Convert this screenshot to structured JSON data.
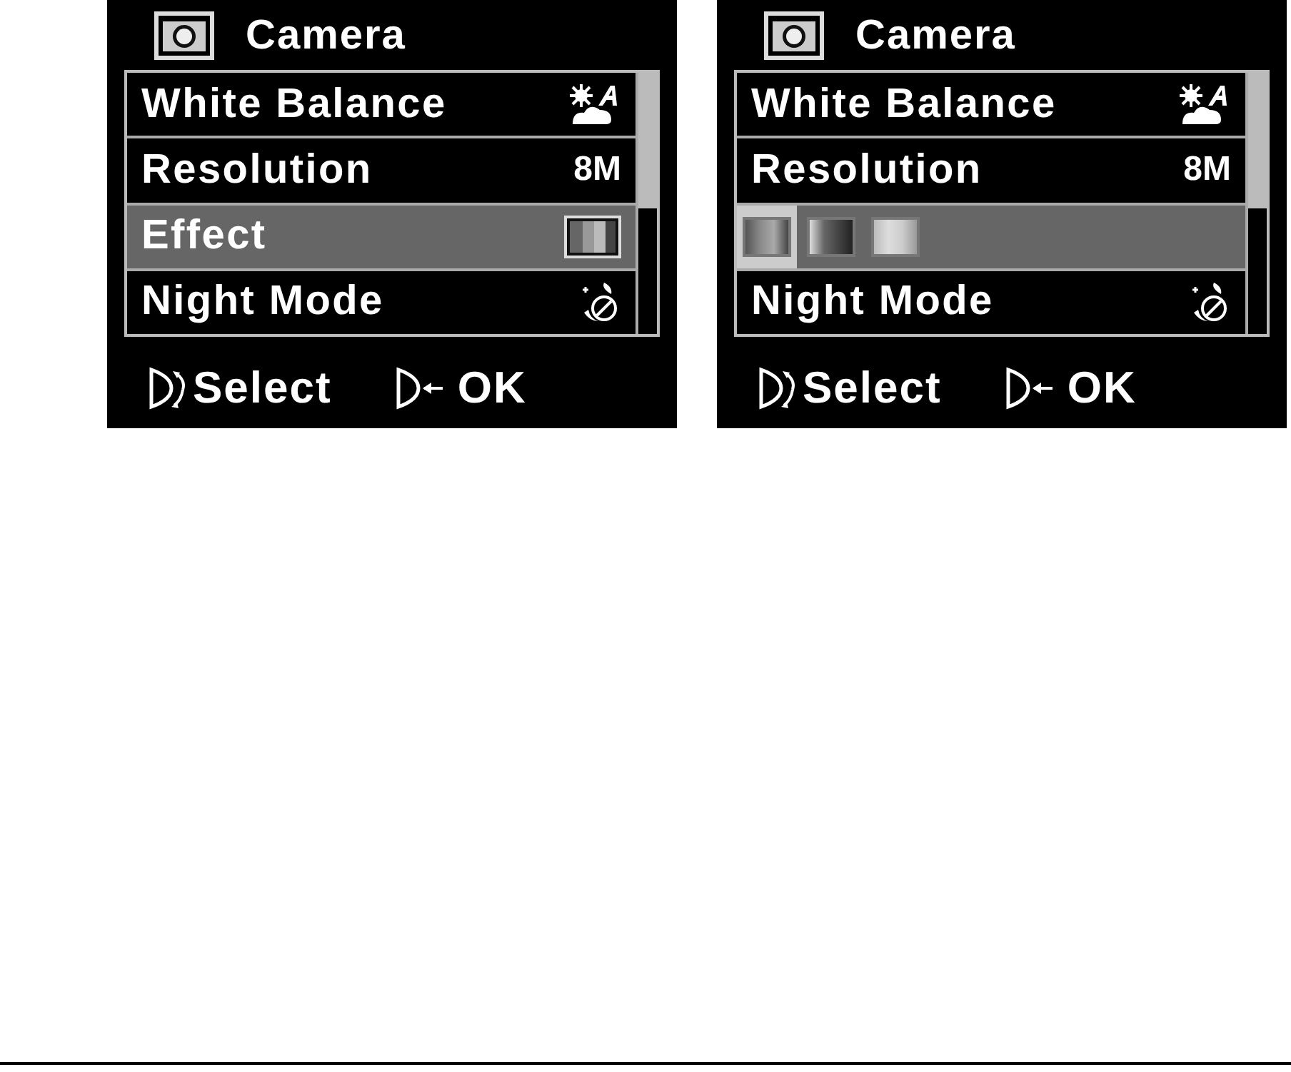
{
  "screens": [
    {
      "title": "Camera",
      "items": [
        {
          "kind": "white-balance",
          "label": "White Balance",
          "selected": false
        },
        {
          "kind": "value",
          "label": "Resolution",
          "value": "8M",
          "selected": false
        },
        {
          "kind": "effect",
          "label": "Effect",
          "selected": true
        },
        {
          "kind": "night",
          "label": "Night Mode",
          "selected": false
        }
      ],
      "footer": [
        {
          "kind": "dial",
          "label": "Select"
        },
        {
          "kind": "enter",
          "label": "OK"
        }
      ]
    },
    {
      "title": "Camera",
      "items": [
        {
          "kind": "white-balance",
          "label": "White Balance",
          "selected": false
        },
        {
          "kind": "value",
          "label": "Resolution",
          "value": "8M",
          "selected": false
        },
        {
          "kind": "effect-options",
          "selected": true,
          "options": [
            {
              "selected": true
            },
            {
              "selected": false
            },
            {
              "selected": false
            }
          ]
        },
        {
          "kind": "night",
          "label": "Night Mode",
          "selected": false
        }
      ],
      "footer": [
        {
          "kind": "dial",
          "label": "Select"
        },
        {
          "kind": "enter",
          "label": "OK"
        }
      ]
    }
  ]
}
